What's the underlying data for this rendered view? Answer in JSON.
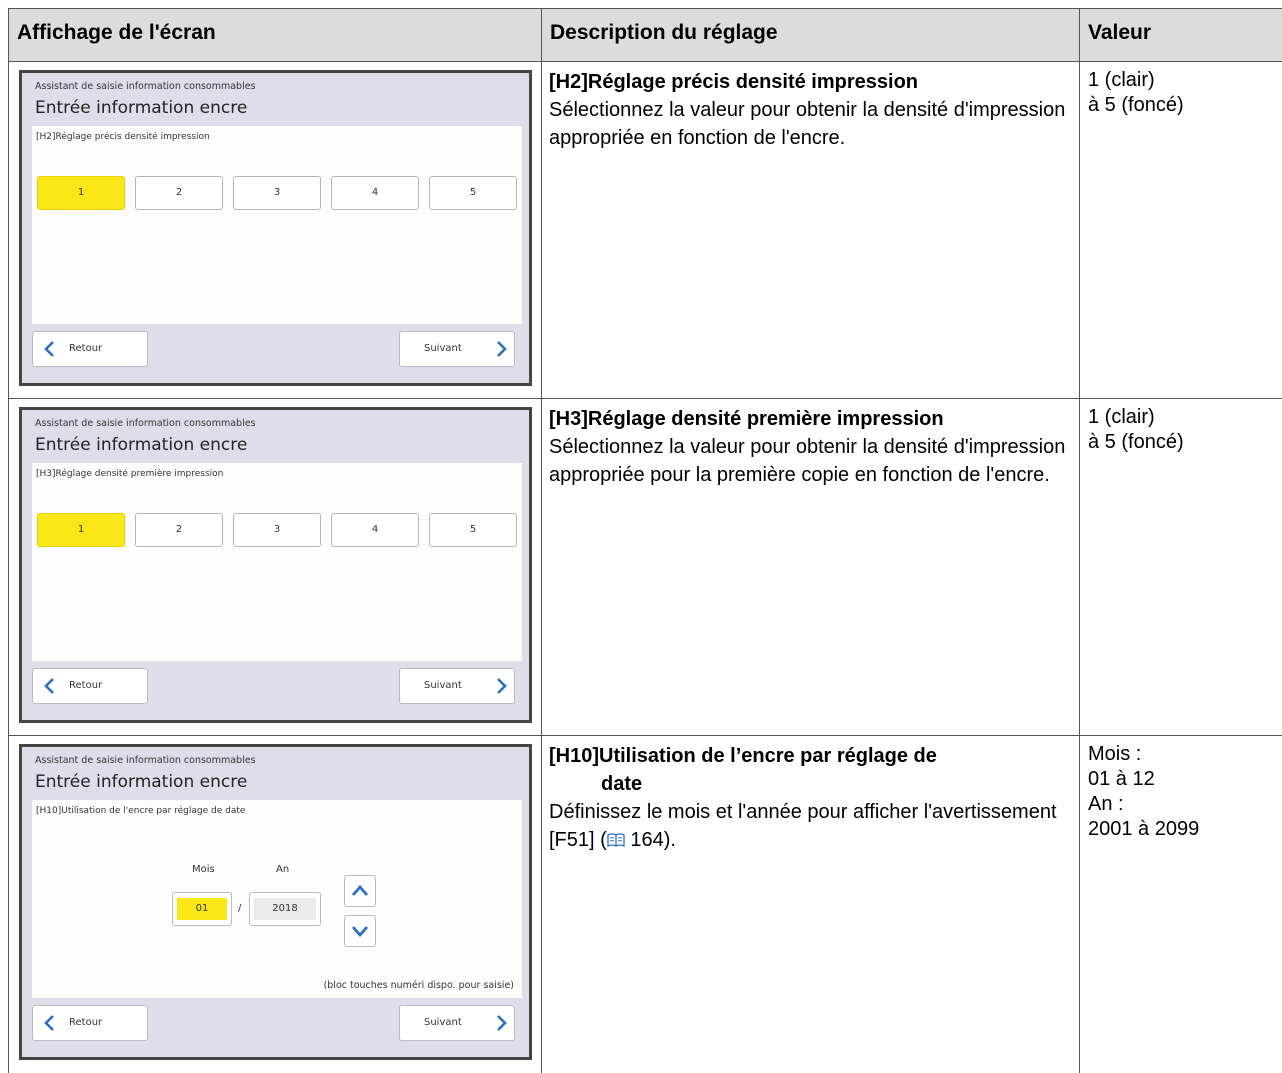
{
  "header": {
    "col_display": "Affichage de l'écran",
    "col_description": "Description du réglage",
    "col_value": "Valeur"
  },
  "screen_common": {
    "subtitle": "Assistant de saisie information consommables",
    "title": "Entrée information encre",
    "back_label": "Retour",
    "next_label": "Suivant"
  },
  "rows": [
    {
      "screen": {
        "label": "[H2]Réglage précis densité impression",
        "options": [
          "1",
          "2",
          "3",
          "4",
          "5"
        ],
        "selected": "1"
      },
      "title": "[H2]Réglage précis densité impression",
      "text": "Sélectionnez la valeur pour obtenir la densité d'impression appropriée en fonction de l'encre.",
      "value_lines": [
        "1 (clair)",
        "à 5 (foncé)"
      ]
    },
    {
      "screen": {
        "label": "[H3]Réglage densité première impression",
        "options": [
          "1",
          "2",
          "3",
          "4",
          "5"
        ],
        "selected": "1"
      },
      "title": "[H3]Réglage densité première impression",
      "text": "Sélectionnez la valeur pour obtenir la densité d'impression appropriée pour la première copie en fonction de l'encre.",
      "value_lines": [
        "1 (clair)",
        "à 5 (foncé)"
      ]
    },
    {
      "screen": {
        "label": "[H10]Utilisation de l'encre par réglage de date",
        "month_label": "Mois",
        "year_label": "An",
        "month_value": "01",
        "separator": "/",
        "year_value": "2018",
        "hint": "(bloc touches numéri dispo. pour saisie)"
      },
      "title_line1": "[H10]Utilisation de l’encre par réglage de",
      "title_line2": "date",
      "text_before_ref": "Définissez le mois et l'année pour afficher l'avertissement [F51] (",
      "ref_page": " 164",
      "text_after_ref": ").",
      "value_lines": [
        "Mois :",
        "01 à 12",
        "An :",
        "2001 à 2099"
      ]
    }
  ],
  "icons": {
    "back": "chevron-left-icon",
    "next": "chevron-right-icon",
    "up": "chevron-up-icon",
    "down": "chevron-down-icon",
    "page_ref": "book-icon"
  },
  "colors": {
    "selected": "#fbe718",
    "arrow_blue": "#2c6fc1",
    "screen_bg": "#dedde9",
    "header_bg": "#dcdcdc"
  }
}
